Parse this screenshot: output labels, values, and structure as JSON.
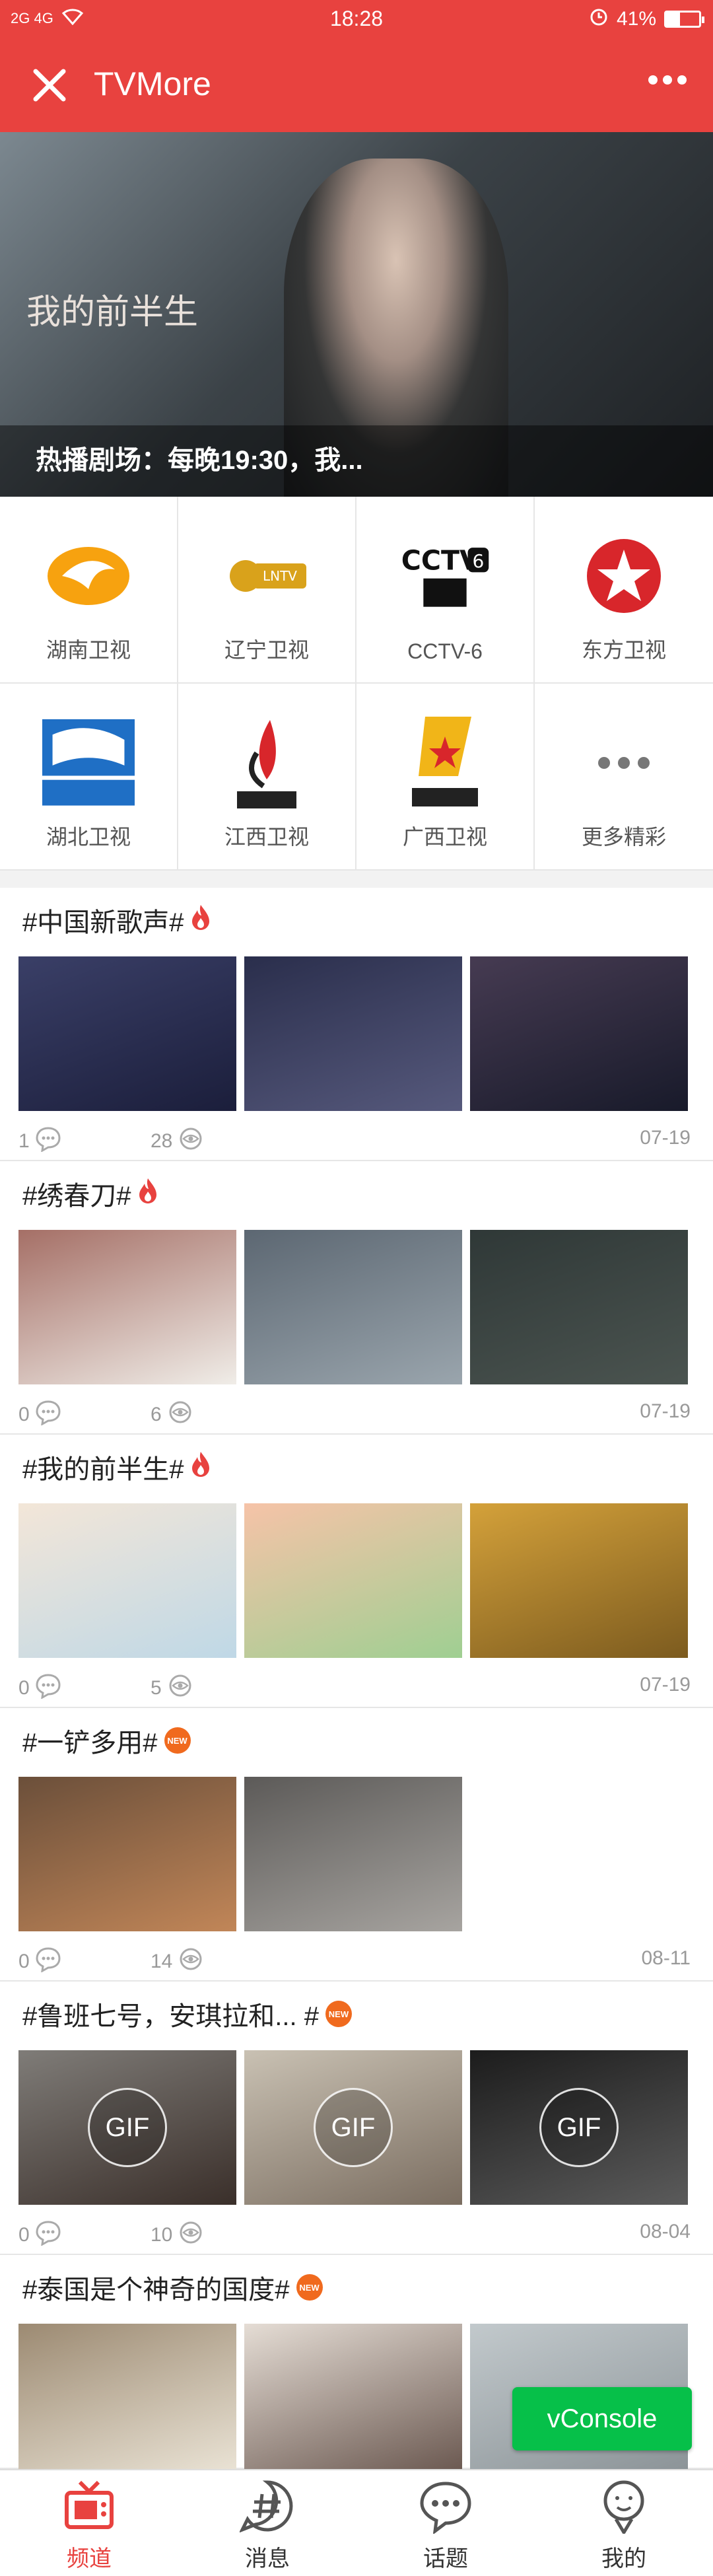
{
  "status_bar": {
    "signal": "2G 4G",
    "time": "18:28",
    "battery": "41%",
    "battery_level": 0.41
  },
  "header": {
    "title": "TVMore",
    "close_icon": "close-icon",
    "more_icon": "more-dots-icon"
  },
  "banner": {
    "caption": "热播剧场：每晚19:30，我...",
    "overlay_text": "我的前半生"
  },
  "channels": [
    {
      "label": "湖南卫视",
      "icon": "hunan-tv-logo"
    },
    {
      "label": "辽宁卫视",
      "icon": "liaoning-tv-logo"
    },
    {
      "label": "CCTV-6",
      "icon": "cctv6-logo"
    },
    {
      "label": "东方卫视",
      "icon": "dragon-tv-logo"
    },
    {
      "label": "湖北卫视",
      "icon": "hubei-tv-logo"
    },
    {
      "label": "江西卫视",
      "icon": "jiangxi-tv-logo"
    },
    {
      "label": "广西卫视",
      "icon": "guangxi-tv-logo"
    },
    {
      "label": "更多精彩",
      "icon": "more-icon"
    }
  ],
  "topics": [
    {
      "title": "#中国新歌声#",
      "badge": "fire",
      "comments": "1",
      "views": "28",
      "date": "07-19",
      "thumb_count": 3,
      "gif": false
    },
    {
      "title": "#绣春刀#",
      "badge": "fire",
      "comments": "0",
      "views": "6",
      "date": "07-19",
      "thumb_count": 3,
      "gif": false
    },
    {
      "title": "#我的前半生#",
      "badge": "fire",
      "comments": "0",
      "views": "5",
      "date": "07-19",
      "thumb_count": 3,
      "gif": false
    },
    {
      "title": "#一铲多用#",
      "badge": "new",
      "comments": "0",
      "views": "14",
      "date": "08-11",
      "thumb_count": 2,
      "gif": false
    },
    {
      "title": "#鲁班七号，安琪拉和...  #",
      "badge": "new",
      "comments": "0",
      "views": "10",
      "date": "08-04",
      "thumb_count": 3,
      "gif": true
    },
    {
      "title": "#泰国是个神奇的国度#",
      "badge": "new",
      "comments": "",
      "views": "",
      "date": "",
      "thumb_count": 3,
      "gif": false
    }
  ],
  "gif_label": "GIF",
  "new_badge_label": "NEW",
  "vconsole": {
    "label": "vConsole"
  },
  "tabbar": [
    {
      "label": "频道",
      "icon": "tv-icon",
      "active": true
    },
    {
      "label": "消息",
      "icon": "hashtag-icon",
      "active": false
    },
    {
      "label": "话题",
      "icon": "chat-bubble-icon",
      "active": false
    },
    {
      "label": "我的",
      "icon": "profile-icon",
      "active": false
    }
  ],
  "colors": {
    "brand": "#e8423f",
    "vconsole": "#06c049",
    "new_badge": "#f06a1e"
  }
}
